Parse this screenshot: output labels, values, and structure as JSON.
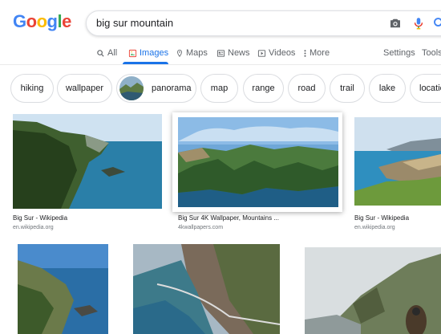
{
  "logo": {
    "letters": [
      "G",
      "o",
      "o",
      "g",
      "l",
      "e"
    ],
    "colors": [
      "#4285F4",
      "#EA4335",
      "#FBBC05",
      "#4285F4",
      "#34A853",
      "#EA4335"
    ]
  },
  "search": {
    "query": "big sur mountain"
  },
  "tabs": [
    {
      "label": "All",
      "icon": "search-icon"
    },
    {
      "label": "Images",
      "icon": "image-icon",
      "active": true
    },
    {
      "label": "Maps",
      "icon": "map-pin-icon"
    },
    {
      "label": "News",
      "icon": "news-icon"
    },
    {
      "label": "Videos",
      "icon": "video-icon"
    },
    {
      "label": "More",
      "icon": "more-vert-icon"
    }
  ],
  "tools": {
    "settings": "Settings",
    "tools": "Tools"
  },
  "chips": [
    "hiking",
    "wallpaper",
    "panorama",
    "map",
    "range",
    "road",
    "trail",
    "lake",
    "location"
  ],
  "results": [
    {
      "title": "Big Sur - Wikipedia",
      "source": "en.wikipedia.org"
    },
    {
      "title": "Big Sur 4K Wallpaper, Mountains ...",
      "source": "4kwallpapers.com"
    },
    {
      "title": "Big Sur - Wikipedia",
      "source": "en.wikipedia.org"
    }
  ],
  "colors": {
    "accent": "#1a73e8",
    "muted": "#5f6368"
  }
}
